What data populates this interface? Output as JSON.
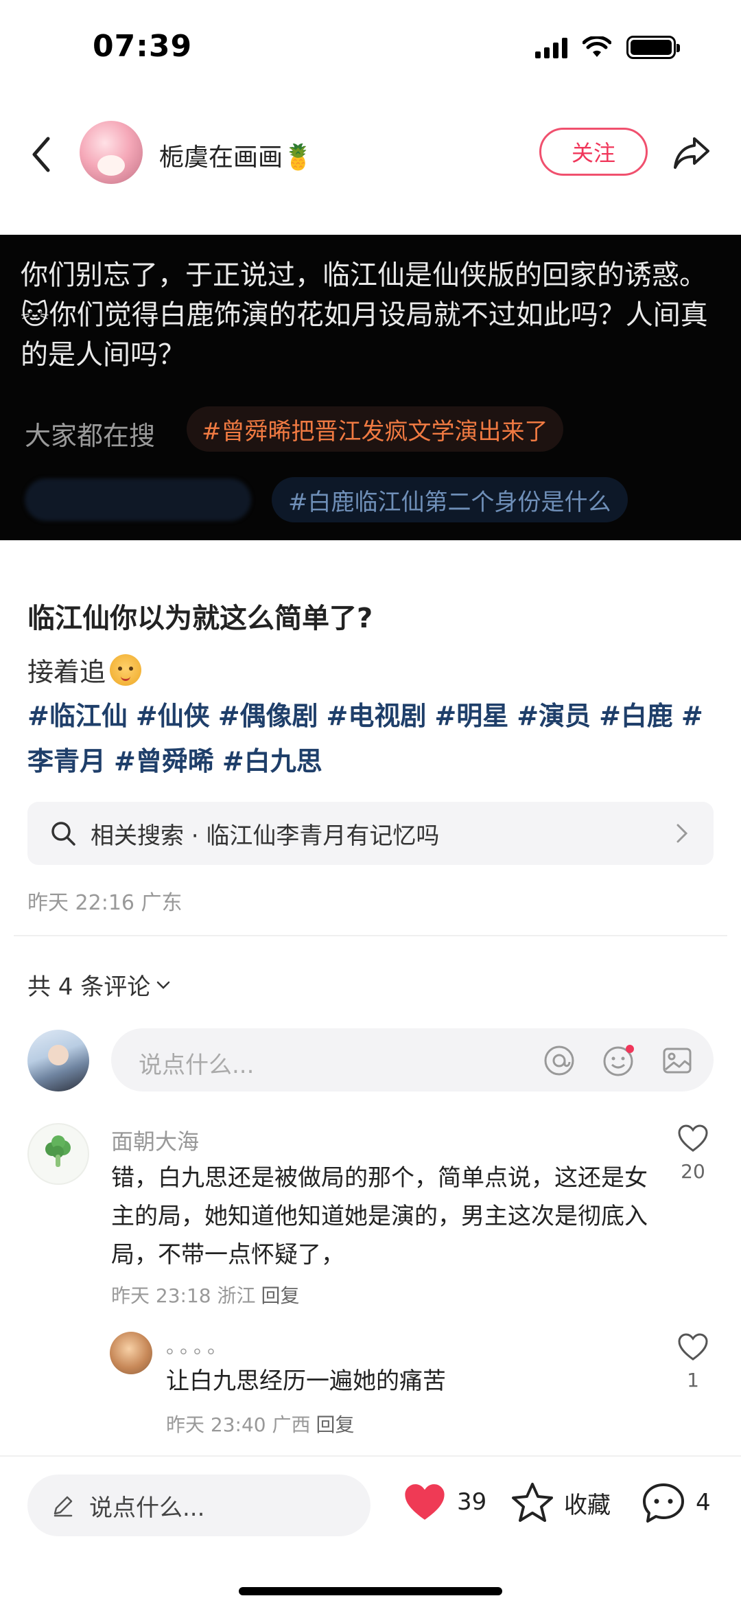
{
  "status_bar": {
    "time": "07:39"
  },
  "header": {
    "author_name": "栀虞在画画🍍",
    "follow_label": "关注"
  },
  "banner": {
    "text": "你们别忘了，于正说过，临江仙是仙侠版的回家的诱惑。🐱你们觉得白鹿饰演的花如月设局就不过如此吗？人间真的是人间吗？",
    "search_label": "大家都在搜",
    "pill_1": "#曾舜晞把晋江发疯文学演出来了",
    "pill_2": "#白鹿临江仙第二个身份是什么"
  },
  "post": {
    "title": "临江仙你以为就这么简单了?",
    "line": "接着追",
    "tags": [
      "#临江仙",
      "#仙侠",
      "#偶像剧",
      "#电视剧",
      "#明星",
      "#演员",
      "#白鹿",
      "#李青月",
      "#曾舜晞",
      "#白九思"
    ],
    "related_search": "相关搜索 · 临江仙李青月有记忆吗",
    "meta": "昨天 22:16 广东"
  },
  "comments": {
    "count_label": "共 4 条评论",
    "input_placeholder": "说点什么...",
    "items": [
      {
        "name": "面朝大海",
        "text": "错，白九思还是被做局的那个，简单点说，这还是女主的局，她知道他知道她是演的，男主这次是彻底入局，不带一点怀疑了，",
        "meta": "昨天 23:18 浙江",
        "reply_label": "回复",
        "likes": "20"
      }
    ],
    "reply": {
      "name": "。。。。",
      "text": "让白九思经历一遍她的痛苦",
      "meta": "昨天 23:40 广西",
      "reply_label": "回复",
      "likes": "1"
    }
  },
  "bottom_bar": {
    "input_placeholder": "说点什么...",
    "like_count": "39",
    "collect_label": "收藏",
    "comment_count": "4"
  },
  "colors": {
    "accent": "#f0365a",
    "tag": "#1f3f6a",
    "like_red": "#ef3a55"
  }
}
